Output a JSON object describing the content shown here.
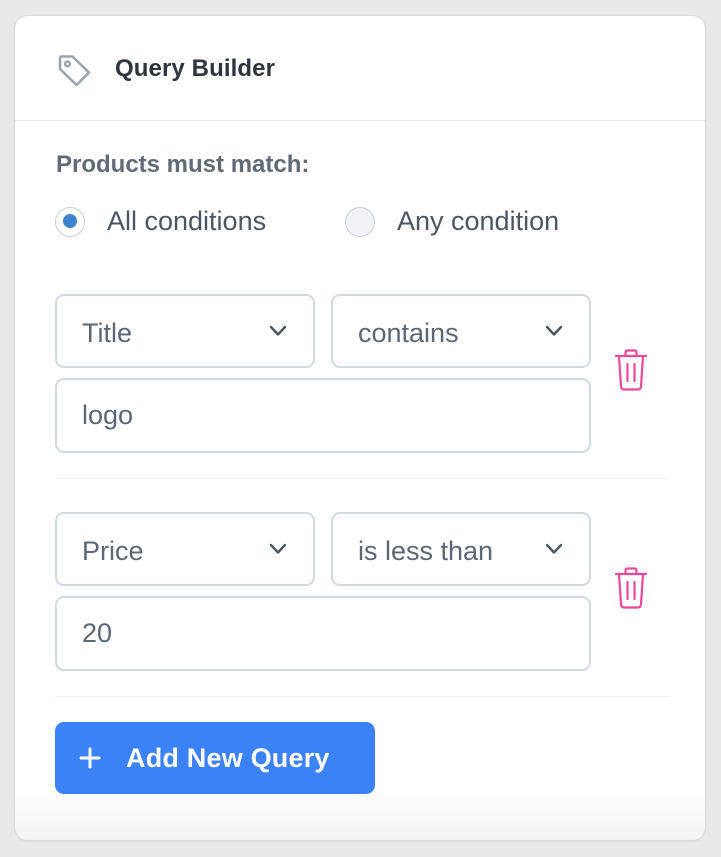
{
  "header": {
    "icon": "tag-icon",
    "title": "Query Builder"
  },
  "match": {
    "label": "Products must match:",
    "options": [
      {
        "label": "All conditions",
        "checked": true
      },
      {
        "label": "Any condition",
        "checked": false
      }
    ]
  },
  "queries": [
    {
      "field": "Title",
      "operator": "contains",
      "value": "logo"
    },
    {
      "field": "Price",
      "operator": "is less than",
      "value": "20"
    }
  ],
  "add_button": {
    "label": "Add New Query",
    "icon": "plus-icon"
  },
  "colors": {
    "accent": "#3b82f6",
    "radio_selected": "#3e83ce",
    "delete": "#ec4899",
    "title": "#2e3440",
    "muted_text": "#606a78"
  }
}
